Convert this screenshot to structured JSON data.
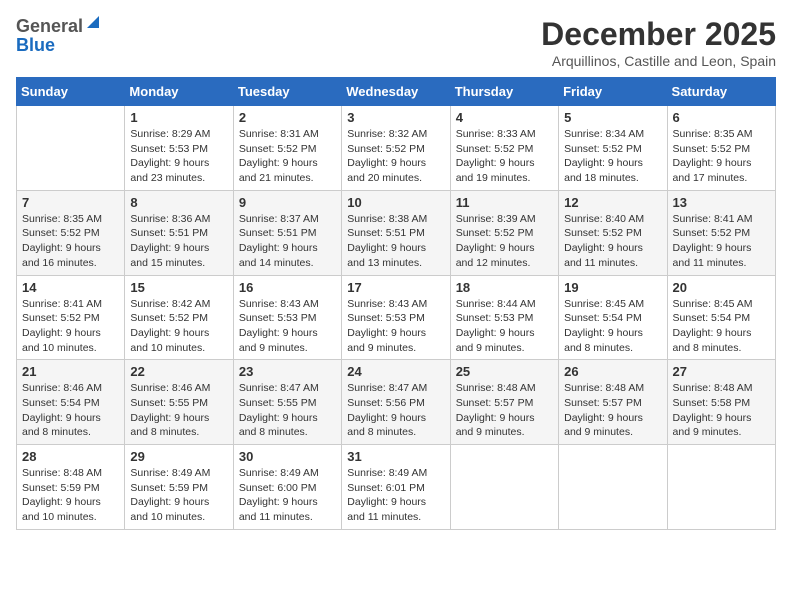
{
  "logo": {
    "general": "General",
    "blue": "Blue"
  },
  "title": "December 2025",
  "location": "Arquillinos, Castille and Leon, Spain",
  "days_of_week": [
    "Sunday",
    "Monday",
    "Tuesday",
    "Wednesday",
    "Thursday",
    "Friday",
    "Saturday"
  ],
  "weeks": [
    [
      {
        "num": "",
        "info": ""
      },
      {
        "num": "1",
        "info": "Sunrise: 8:29 AM\nSunset: 5:53 PM\nDaylight: 9 hours\nand 23 minutes."
      },
      {
        "num": "2",
        "info": "Sunrise: 8:31 AM\nSunset: 5:52 PM\nDaylight: 9 hours\nand 21 minutes."
      },
      {
        "num": "3",
        "info": "Sunrise: 8:32 AM\nSunset: 5:52 PM\nDaylight: 9 hours\nand 20 minutes."
      },
      {
        "num": "4",
        "info": "Sunrise: 8:33 AM\nSunset: 5:52 PM\nDaylight: 9 hours\nand 19 minutes."
      },
      {
        "num": "5",
        "info": "Sunrise: 8:34 AM\nSunset: 5:52 PM\nDaylight: 9 hours\nand 18 minutes."
      },
      {
        "num": "6",
        "info": "Sunrise: 8:35 AM\nSunset: 5:52 PM\nDaylight: 9 hours\nand 17 minutes."
      }
    ],
    [
      {
        "num": "7",
        "info": "Sunrise: 8:35 AM\nSunset: 5:52 PM\nDaylight: 9 hours\nand 16 minutes."
      },
      {
        "num": "8",
        "info": "Sunrise: 8:36 AM\nSunset: 5:51 PM\nDaylight: 9 hours\nand 15 minutes."
      },
      {
        "num": "9",
        "info": "Sunrise: 8:37 AM\nSunset: 5:51 PM\nDaylight: 9 hours\nand 14 minutes."
      },
      {
        "num": "10",
        "info": "Sunrise: 8:38 AM\nSunset: 5:51 PM\nDaylight: 9 hours\nand 13 minutes."
      },
      {
        "num": "11",
        "info": "Sunrise: 8:39 AM\nSunset: 5:52 PM\nDaylight: 9 hours\nand 12 minutes."
      },
      {
        "num": "12",
        "info": "Sunrise: 8:40 AM\nSunset: 5:52 PM\nDaylight: 9 hours\nand 11 minutes."
      },
      {
        "num": "13",
        "info": "Sunrise: 8:41 AM\nSunset: 5:52 PM\nDaylight: 9 hours\nand 11 minutes."
      }
    ],
    [
      {
        "num": "14",
        "info": "Sunrise: 8:41 AM\nSunset: 5:52 PM\nDaylight: 9 hours\nand 10 minutes."
      },
      {
        "num": "15",
        "info": "Sunrise: 8:42 AM\nSunset: 5:52 PM\nDaylight: 9 hours\nand 10 minutes."
      },
      {
        "num": "16",
        "info": "Sunrise: 8:43 AM\nSunset: 5:53 PM\nDaylight: 9 hours\nand 9 minutes."
      },
      {
        "num": "17",
        "info": "Sunrise: 8:43 AM\nSunset: 5:53 PM\nDaylight: 9 hours\nand 9 minutes."
      },
      {
        "num": "18",
        "info": "Sunrise: 8:44 AM\nSunset: 5:53 PM\nDaylight: 9 hours\nand 9 minutes."
      },
      {
        "num": "19",
        "info": "Sunrise: 8:45 AM\nSunset: 5:54 PM\nDaylight: 9 hours\nand 8 minutes."
      },
      {
        "num": "20",
        "info": "Sunrise: 8:45 AM\nSunset: 5:54 PM\nDaylight: 9 hours\nand 8 minutes."
      }
    ],
    [
      {
        "num": "21",
        "info": "Sunrise: 8:46 AM\nSunset: 5:54 PM\nDaylight: 9 hours\nand 8 minutes."
      },
      {
        "num": "22",
        "info": "Sunrise: 8:46 AM\nSunset: 5:55 PM\nDaylight: 9 hours\nand 8 minutes."
      },
      {
        "num": "23",
        "info": "Sunrise: 8:47 AM\nSunset: 5:55 PM\nDaylight: 9 hours\nand 8 minutes."
      },
      {
        "num": "24",
        "info": "Sunrise: 8:47 AM\nSunset: 5:56 PM\nDaylight: 9 hours\nand 8 minutes."
      },
      {
        "num": "25",
        "info": "Sunrise: 8:48 AM\nSunset: 5:57 PM\nDaylight: 9 hours\nand 9 minutes."
      },
      {
        "num": "26",
        "info": "Sunrise: 8:48 AM\nSunset: 5:57 PM\nDaylight: 9 hours\nand 9 minutes."
      },
      {
        "num": "27",
        "info": "Sunrise: 8:48 AM\nSunset: 5:58 PM\nDaylight: 9 hours\nand 9 minutes."
      }
    ],
    [
      {
        "num": "28",
        "info": "Sunrise: 8:48 AM\nSunset: 5:59 PM\nDaylight: 9 hours\nand 10 minutes."
      },
      {
        "num": "29",
        "info": "Sunrise: 8:49 AM\nSunset: 5:59 PM\nDaylight: 9 hours\nand 10 minutes."
      },
      {
        "num": "30",
        "info": "Sunrise: 8:49 AM\nSunset: 6:00 PM\nDaylight: 9 hours\nand 11 minutes."
      },
      {
        "num": "31",
        "info": "Sunrise: 8:49 AM\nSunset: 6:01 PM\nDaylight: 9 hours\nand 11 minutes."
      },
      {
        "num": "",
        "info": ""
      },
      {
        "num": "",
        "info": ""
      },
      {
        "num": "",
        "info": ""
      }
    ]
  ]
}
